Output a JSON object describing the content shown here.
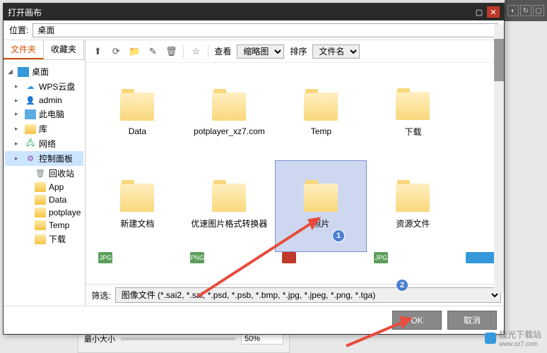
{
  "titlebar": {
    "title": "打开画布"
  },
  "location": {
    "label": "位置:",
    "value": "桌面"
  },
  "sidebar": {
    "tabs": [
      "文件夹",
      "收藏夹"
    ],
    "items": [
      {
        "label": "桌面",
        "icon": "desktop",
        "expanded": true,
        "indent": 0
      },
      {
        "label": "WPS云盘",
        "icon": "cloud",
        "indent": 1
      },
      {
        "label": "admin",
        "icon": "user",
        "indent": 1
      },
      {
        "label": "此电脑",
        "icon": "pc",
        "indent": 1
      },
      {
        "label": "库",
        "icon": "folder",
        "indent": 1
      },
      {
        "label": "网络",
        "icon": "net",
        "indent": 1
      },
      {
        "label": "控制面板",
        "icon": "ctrl",
        "indent": 1,
        "selected": true
      },
      {
        "label": "回收站",
        "icon": "recycle",
        "indent": 2
      },
      {
        "label": "App",
        "icon": "folder",
        "indent": 2
      },
      {
        "label": "Data",
        "icon": "folder",
        "indent": 2
      },
      {
        "label": "potplaye",
        "icon": "folder",
        "indent": 2
      },
      {
        "label": "Temp",
        "icon": "folder",
        "indent": 2
      },
      {
        "label": "下载",
        "icon": "folder",
        "indent": 2
      }
    ]
  },
  "toolbar": {
    "view_label": "查看",
    "view_value": "缩略图",
    "sort_label": "排序",
    "sort_value": "文件名"
  },
  "files": {
    "row1": [
      {
        "name": "Data"
      },
      {
        "name": "potplayer_xz7.com"
      },
      {
        "name": "Temp"
      },
      {
        "name": "下载"
      }
    ],
    "row2": [
      {
        "name": "新建文档"
      },
      {
        "name": "优速图片格式转换器"
      },
      {
        "name": "照片",
        "selected": true
      },
      {
        "name": "资源文件"
      }
    ],
    "thumbs": [
      "JPG",
      "PNG",
      "",
      "JPG",
      ""
    ]
  },
  "filter": {
    "label": "筛选:",
    "value": "图像文件 (*.sai2, *.sai, *.psd, *.psb, *.bmp, *.jpg, *.jpeg, *.png, *.tga)"
  },
  "buttons": {
    "ok": "OK",
    "cancel": "取消"
  },
  "annotations": {
    "badge1": "1",
    "badge2": "2"
  },
  "bottom": {
    "label": "最小大小",
    "value": "50%"
  },
  "watermark": {
    "text": "极光下载站",
    "url": "www.xz7.com"
  }
}
